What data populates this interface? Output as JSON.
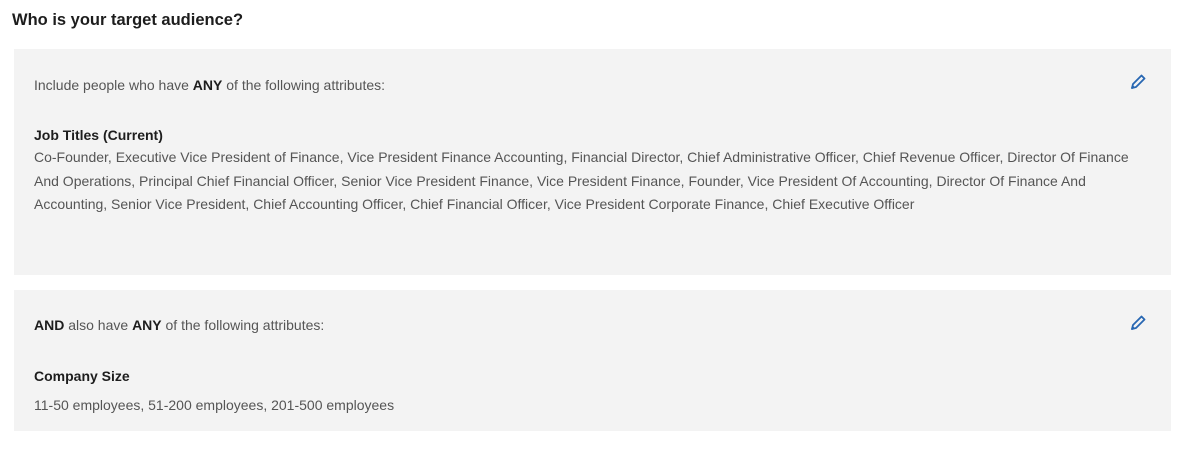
{
  "page": {
    "heading": "Who is your target audience?"
  },
  "sections": [
    {
      "intro_prefix": "Include people who have ",
      "intro_strong": "ANY",
      "intro_suffix": " of the following attributes:",
      "criteria_label": "Job Titles (Current)",
      "criteria_values": "Co-Founder, Executive Vice President of Finance, Vice President Finance Accounting, Financial Director, Chief Administrative Officer, Chief Revenue Officer, Director Of Finance And Operations, Principal Chief Financial Officer, Senior Vice President Finance, Vice President Finance, Founder, Vice President Of Accounting, Director Of Finance And Accounting, Senior Vice President, Chief Accounting Officer, Chief Financial Officer, Vice President Corporate Finance, Chief Executive Officer"
    },
    {
      "intro_and": "AND",
      "intro_prefix": " also have ",
      "intro_strong": "ANY",
      "intro_suffix": " of the following attributes:",
      "criteria_label": "Company Size",
      "criteria_values": "11-50 employees, 51-200 employees, 201-500 employees"
    }
  ],
  "icons": {
    "edit": "pencil-icon"
  },
  "colors": {
    "card_background": "#f3f3f3",
    "edit_icon": "#2867b2",
    "muted_text": "#555555",
    "strong_text": "#1d1d1d"
  }
}
